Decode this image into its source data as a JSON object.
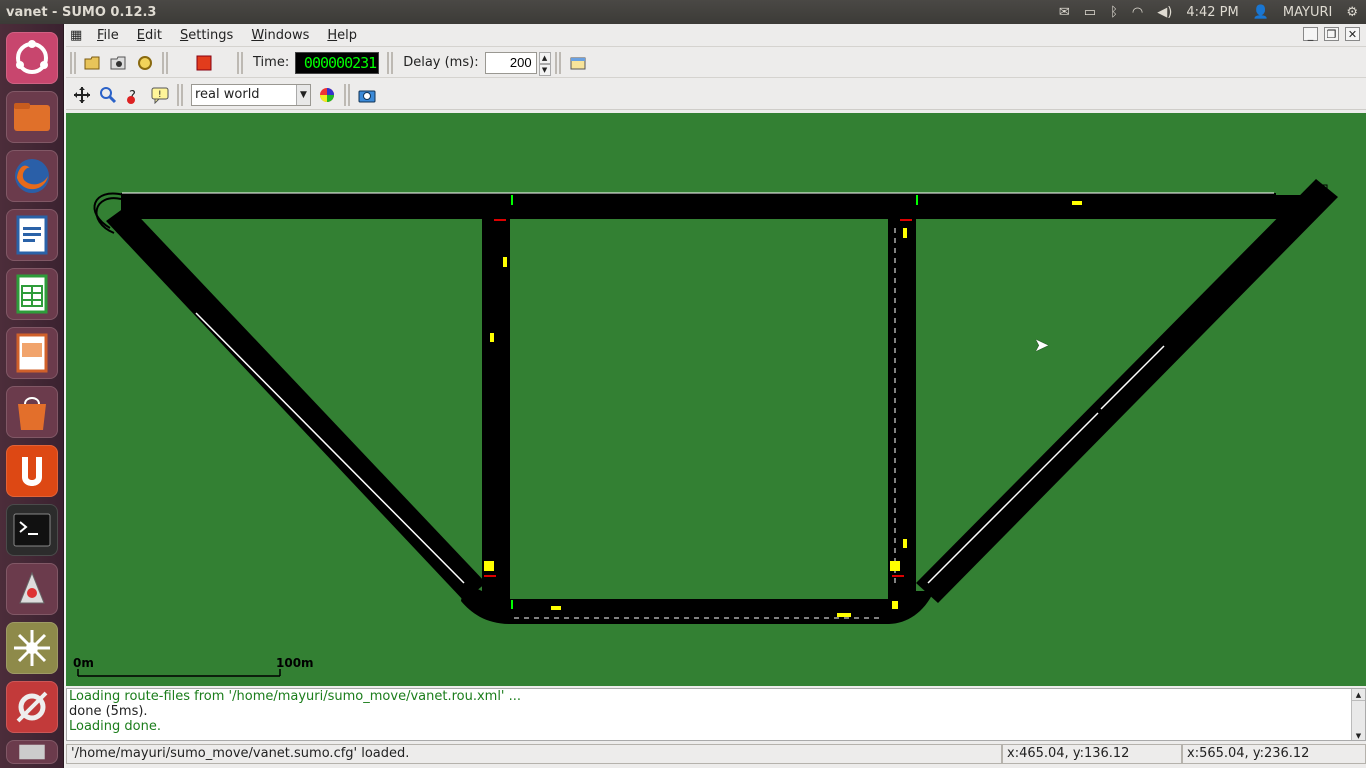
{
  "topbar": {
    "title": "vanet - SUMO 0.12.3",
    "time": "4:42 PM",
    "user": "MAYURI"
  },
  "menu": {
    "items": [
      "File",
      "Edit",
      "Settings",
      "Windows",
      "Help"
    ]
  },
  "toolbar": {
    "time_label": "Time:",
    "time_value": "000000231",
    "delay_label": "Delay (ms):",
    "delay_value": "200",
    "scheme_value": "real world"
  },
  "canvas": {
    "scale_start": "0m",
    "scale_end": "100m",
    "bg_color": "#338033"
  },
  "log": {
    "lines": [
      "Loading route-files from '/home/mayuri/sumo_move/vanet.rou.xml' ...",
      " done (5ms).",
      "Loading done."
    ]
  },
  "status": {
    "message": "'/home/mayuri/sumo_move/vanet.sumo.cfg' loaded.",
    "coord1": "x:465.04, y:136.12",
    "coord2": "x:565.04, y:236.12"
  }
}
